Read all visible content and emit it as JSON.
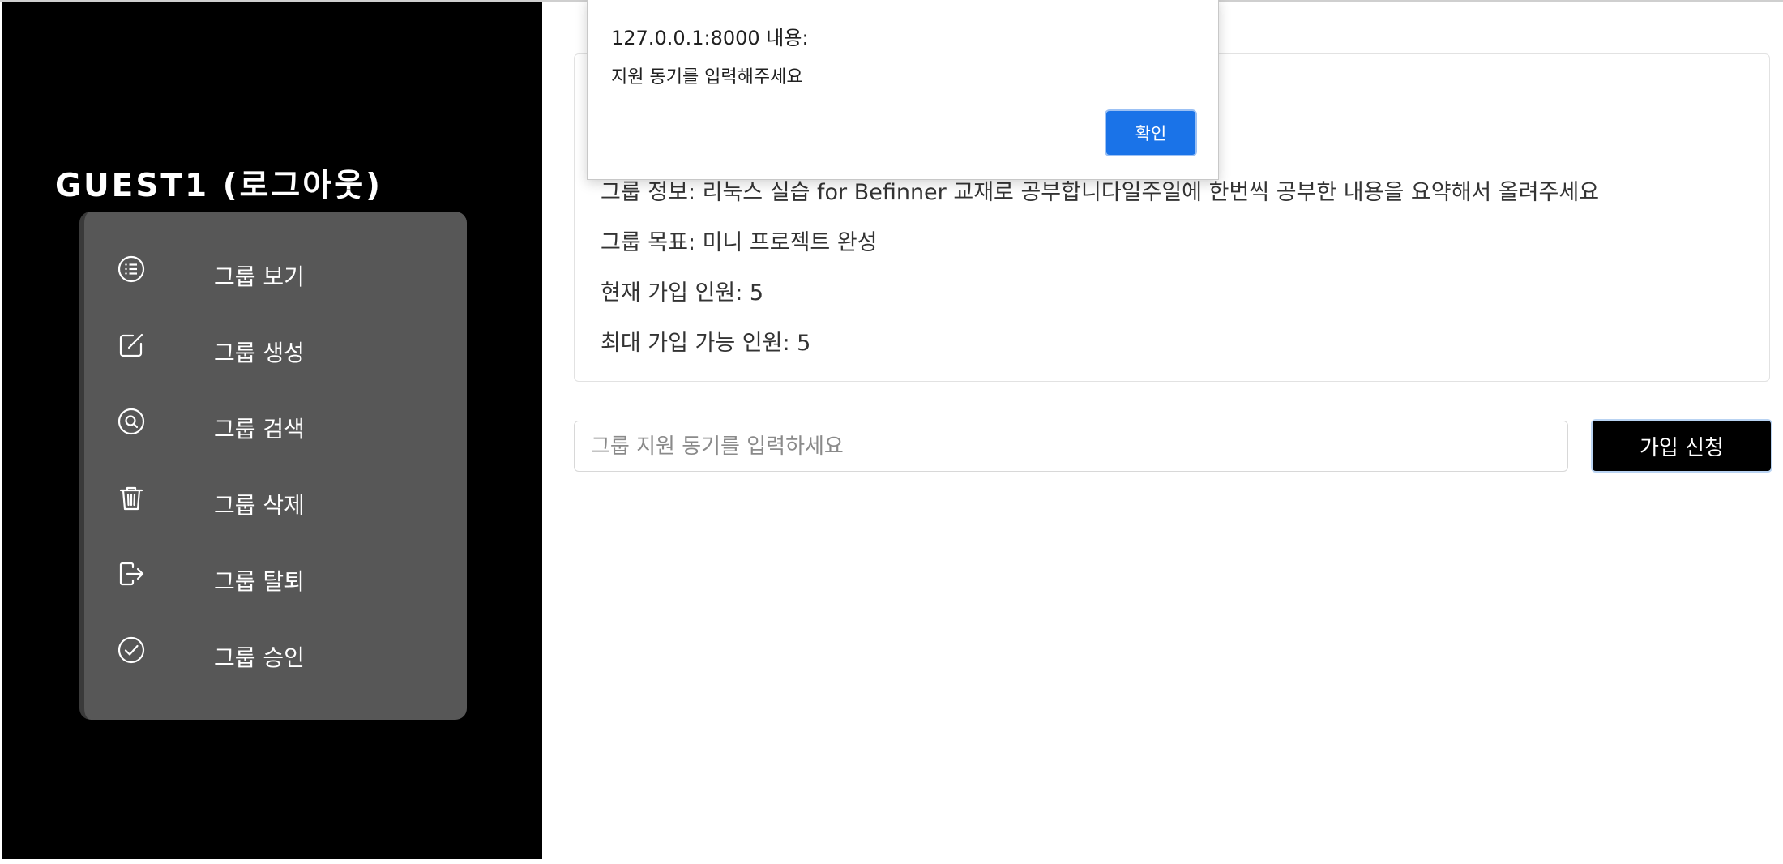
{
  "sidebar": {
    "user_label": "GUEST1 (로그아웃)",
    "menu": [
      {
        "label": "그룹 보기",
        "icon": "list-circle-icon"
      },
      {
        "label": "그룹 생성",
        "icon": "edit-square-icon"
      },
      {
        "label": "그룹 검색",
        "icon": "search-circle-icon"
      },
      {
        "label": "그룹 삭제",
        "icon": "trash-icon"
      },
      {
        "label": "그룹 탈퇴",
        "icon": "logout-icon"
      },
      {
        "label": "그룹 승인",
        "icon": "check-circle-icon"
      }
    ]
  },
  "group_info": {
    "info_line": "그룹 정보: 리눅스 실습 for Befinner 교재로 공부합니다일주일에 한번씩 공부한 내용을 요약해서 올려주세요",
    "goal_line": "그룹 목표: 미니 프로젝트 완성",
    "current_members_line": "현재 가입 인원: 5",
    "max_members_line": "최대 가입 가능 인원: 5"
  },
  "application": {
    "motive_placeholder": "그룹 지원 동기를 입력하세요",
    "motive_value": "",
    "join_button_label": "가입 신청"
  },
  "alert": {
    "title": "127.0.0.1:8000 내용:",
    "message": "지원 동기를 입력해주세요",
    "ok_label": "확인"
  },
  "colors": {
    "sidebar_bg": "#000000",
    "menu_panel_bg": "#575757",
    "primary_button": "#1a73e8",
    "join_button_bg": "#000000"
  }
}
